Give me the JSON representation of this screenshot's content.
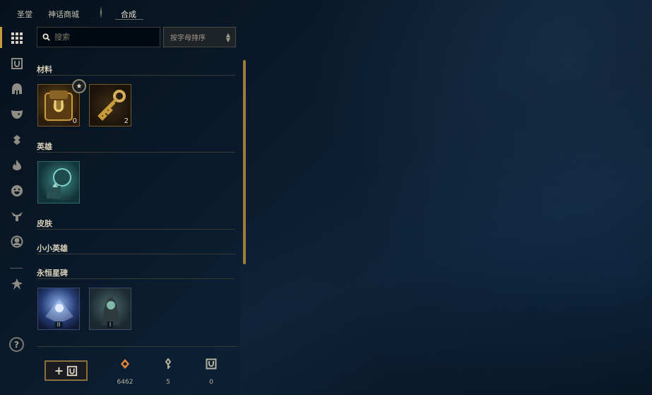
{
  "nav": {
    "tabs": [
      {
        "label": "圣堂"
      },
      {
        "label": "神话商城"
      },
      {
        "label": "合成"
      }
    ]
  },
  "search": {
    "placeholder": "搜索",
    "value": ""
  },
  "sort": {
    "selected": "按字母排序"
  },
  "sections": [
    {
      "title": "材料",
      "items": [
        {
          "name": "chest-with-key",
          "count": "0"
        },
        {
          "name": "hextech-key",
          "count": "2"
        }
      ]
    },
    {
      "title": "英雄",
      "items": [
        {
          "name": "champion-shard"
        }
      ]
    },
    {
      "title": "皮肤",
      "items": []
    },
    {
      "title": "小小英雄",
      "items": []
    },
    {
      "title": "永恒星碑",
      "items": [
        {
          "name": "eternals-series-2",
          "tier": "II"
        },
        {
          "name": "eternals-series-1",
          "tier": "I"
        }
      ]
    }
  ],
  "help": {
    "label": "?"
  },
  "footer": {
    "add_label": "+",
    "currencies": [
      {
        "icon": "orange-essence-icon",
        "value": "6462"
      },
      {
        "icon": "key-fragment-icon",
        "value": "5"
      },
      {
        "icon": "mythic-essence-icon",
        "value": "0"
      }
    ]
  },
  "colors": {
    "accent": "#c89b3c",
    "gold_border": "#785a28",
    "background": "#0a1a2b"
  }
}
